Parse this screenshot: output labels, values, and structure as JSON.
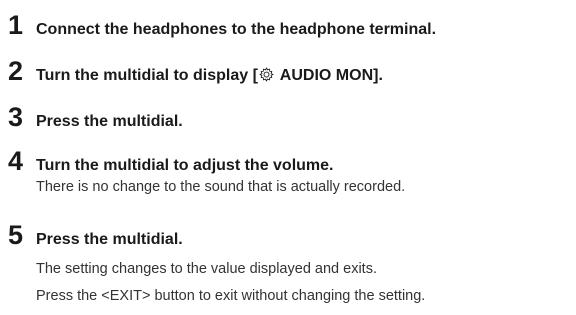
{
  "steps": [
    {
      "number": "1",
      "title": "Connect the headphones to the headphone terminal."
    },
    {
      "number": "2",
      "title_before": "Turn the multidial to display [",
      "icon": "gear-settings-icon",
      "title_after": " AUDIO MON]."
    },
    {
      "number": "3",
      "title": "Press the multidial."
    },
    {
      "number": "4",
      "title": "Turn the multidial to adjust the volume.",
      "notes": [
        "There is no change to the sound that is actually recorded."
      ]
    },
    {
      "number": "5",
      "title": "Press the multidial.",
      "notes": [
        "The setting changes to the value displayed and exits.",
        "Press the <EXIT> button to exit without changing the setting."
      ]
    }
  ]
}
